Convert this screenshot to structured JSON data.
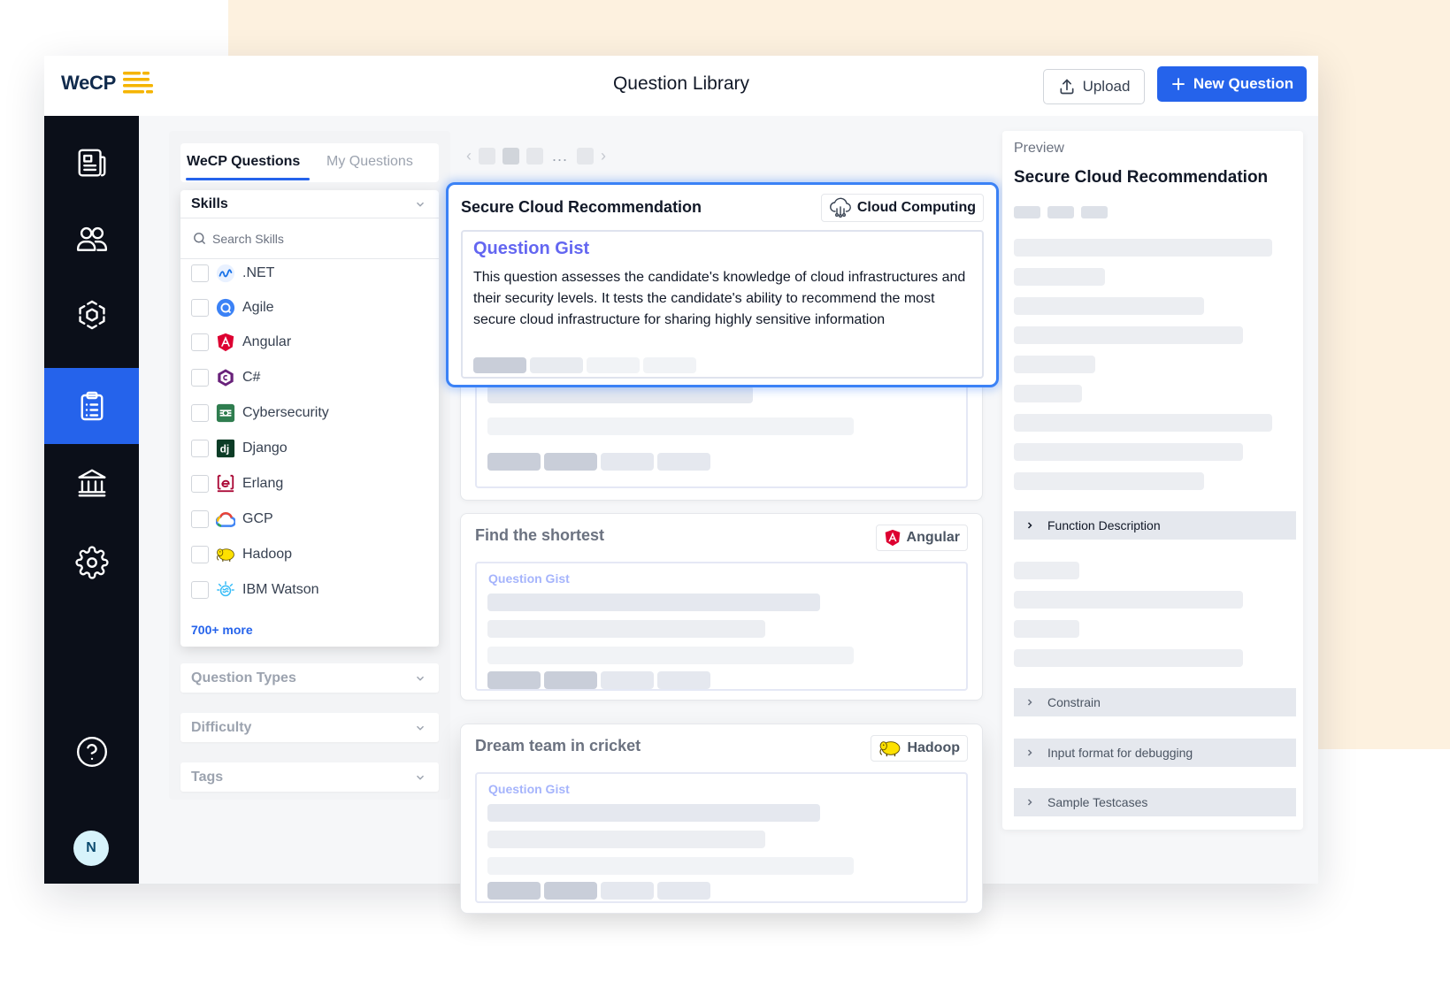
{
  "brand": {
    "name": "WeCP",
    "accent": "#2563eb",
    "logo_stripe_color": "#f5b400"
  },
  "header": {
    "title": "Question Library",
    "upload_label": "Upload",
    "new_question_label": "New Question"
  },
  "sidebar": {
    "items": [
      {
        "icon": "newspaper-icon",
        "active": false
      },
      {
        "icon": "users-icon",
        "active": false
      },
      {
        "icon": "hexagon-network-icon",
        "active": false
      },
      {
        "icon": "clipboard-list-icon",
        "active": true
      },
      {
        "icon": "bank-building-icon",
        "active": false
      },
      {
        "icon": "gear-icon",
        "active": false
      }
    ],
    "help_icon": "help-circle-icon",
    "avatar_initial": "N"
  },
  "filters": {
    "tabs": [
      {
        "label": "WeCP Questions",
        "active": true
      },
      {
        "label": "My Questions",
        "active": false
      }
    ],
    "skills": {
      "heading": "Skills",
      "search_placeholder": "Search Skills",
      "items": [
        {
          "label": ".NET",
          "icon": "dotnet-icon"
        },
        {
          "label": "Agile",
          "icon": "agile-icon"
        },
        {
          "label": "Angular",
          "icon": "angular-icon"
        },
        {
          "label": "C#",
          "icon": "csharp-icon"
        },
        {
          "label": "Cybersecurity",
          "icon": "cybersecurity-icon"
        },
        {
          "label": "Django",
          "icon": "django-icon"
        },
        {
          "label": "Erlang",
          "icon": "erlang-icon"
        },
        {
          "label": "GCP",
          "icon": "gcp-icon"
        },
        {
          "label": "Hadoop",
          "icon": "hadoop-icon"
        },
        {
          "label": "IBM Watson",
          "icon": "ibm-watson-icon"
        }
      ],
      "more_label": "700+ more"
    },
    "collapsed_sections": [
      "Question Types",
      "Difficulty",
      "Tags"
    ]
  },
  "questions": {
    "focused": {
      "title": "Secure Cloud Recommendation",
      "tag": "Cloud Computing",
      "gist_label": "Question Gist",
      "gist_text": "This question assesses the candidate's knowledge of cloud infrastructures and their security levels. It tests the candidate's ability to recommend the most secure cloud infrastructure for sharing highly sensitive information"
    },
    "cards": [
      {
        "title": "Find the shortest",
        "tag": "Angular",
        "tag_icon": "angular-icon",
        "gist_label": "Question Gist"
      },
      {
        "title": "Dream team in cricket",
        "tag": "Hadoop",
        "tag_icon": "hadoop-icon",
        "gist_label": "Question Gist"
      }
    ]
  },
  "preview": {
    "label": "Preview",
    "title": "Secure Cloud Recommendation",
    "sections": [
      "Function Description",
      "Constrain",
      "Input format for debugging",
      "Sample Testcases"
    ]
  }
}
